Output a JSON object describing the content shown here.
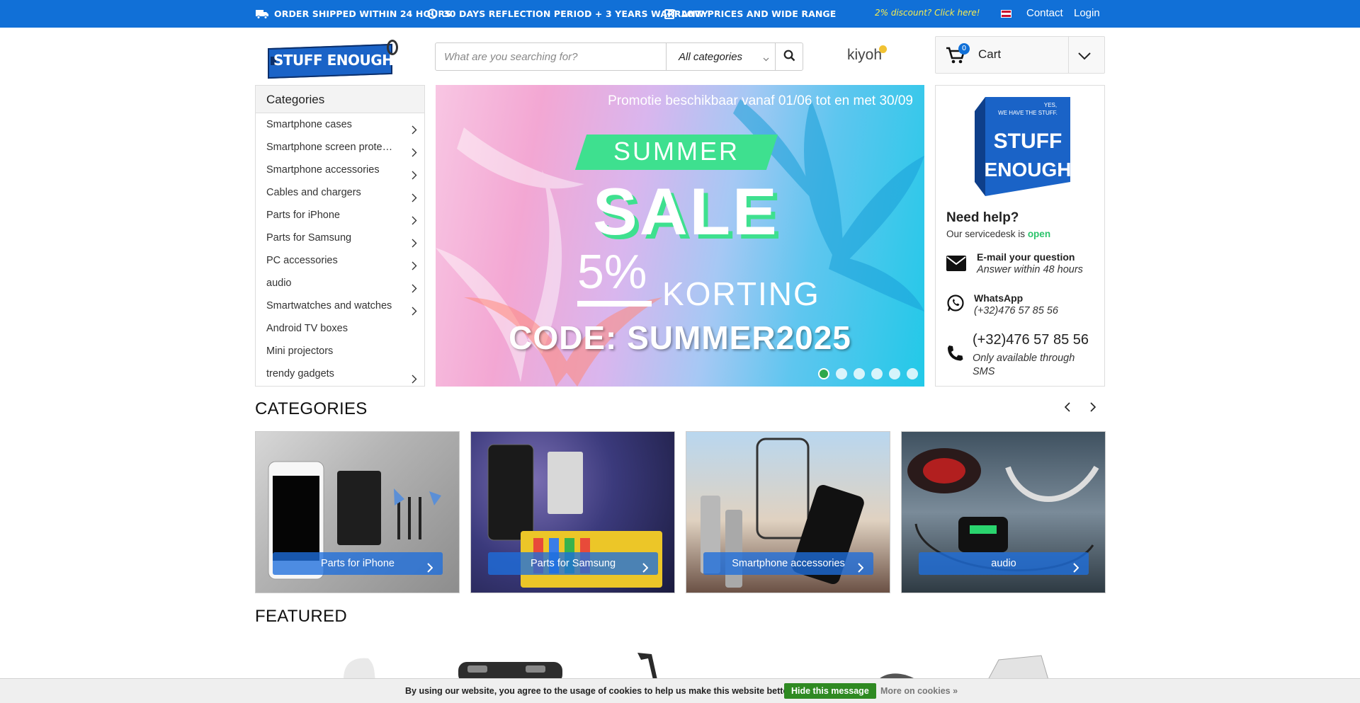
{
  "topbar": {
    "usps": [
      {
        "icon": "truck-icon",
        "text": "ORDER SHIPPED WITHIN 24 HOURS"
      },
      {
        "icon": "clock-icon",
        "text": "30 DAYS REFLECTION PERIOD + 3 YEARS WARRANTY"
      },
      {
        "icon": "check-square-icon",
        "text": "LOW PRICES AND WIDE RANGE"
      }
    ],
    "promo": "2% discount? Click here!",
    "language_flag": "uk-flag-icon",
    "contact": "Contact",
    "login": "Login"
  },
  "header": {
    "logo_text": "STUFF ENOUGH.BE",
    "search": {
      "placeholder": "What are you searching for?",
      "value": "",
      "category": "All categories"
    },
    "kiyoh": "kiyoh",
    "cart": {
      "label": "Cart",
      "count": "0"
    }
  },
  "sidebar": {
    "title": "Categories",
    "items": [
      {
        "label": "Smartphone cases",
        "has_sub": true
      },
      {
        "label": "Smartphone screen protectors",
        "has_sub": true
      },
      {
        "label": "Smartphone accessories",
        "has_sub": true
      },
      {
        "label": "Cables and chargers",
        "has_sub": true
      },
      {
        "label": "Parts for iPhone",
        "has_sub": true
      },
      {
        "label": "Parts for Samsung",
        "has_sub": true
      },
      {
        "label": "PC accessories",
        "has_sub": true
      },
      {
        "label": "audio",
        "has_sub": true
      },
      {
        "label": "Smartwatches and watches",
        "has_sub": true
      },
      {
        "label": "Android TV boxes",
        "has_sub": false
      },
      {
        "label": "Mini projectors",
        "has_sub": false
      },
      {
        "label": "trendy gadgets",
        "has_sub": true
      }
    ]
  },
  "banner": {
    "availability": "Promotie beschikbaar vanaf 01/06 tot en met 30/09",
    "summer": "SUMMER",
    "sale": "SALE",
    "percent": "5%",
    "korting": "KORTING",
    "code": "CODE: SUMMER2025",
    "slide_count": 6,
    "active_slide": 1,
    "accent": "#3ee08f"
  },
  "help": {
    "cube_line1": "YES,",
    "cube_line2": "WE HAVE THE STUFF.",
    "cube_brand1": "STUFF",
    "cube_brand2": "ENOUGH",
    "title": "Need help?",
    "desk_prefix": "Our servicedesk is",
    "desk_status": "open",
    "email_title": "E-mail your question",
    "email_sub": "Answer within 48 hours",
    "whatsapp_title": "WhatsApp",
    "whatsapp_sub": "(+32)476 57 85 56",
    "phone_title": "(+32)476 57 85 56",
    "phone_sub": "Only available through SMS"
  },
  "categories_section": {
    "title": "CATEGORIES",
    "cards": [
      {
        "label": "Parts for iPhone"
      },
      {
        "label": "Parts for Samsung"
      },
      {
        "label": "Smartphone accessories"
      },
      {
        "label": "audio"
      }
    ]
  },
  "featured_section": {
    "title": "FEATURED"
  },
  "cookie": {
    "message": "By using our website, you agree to the usage of cookies to help us make this website better.",
    "hide": "Hide this message",
    "more": "More on cookies »"
  },
  "colors": {
    "brand_blue": "#1170d7",
    "open_green": "#2bc36b",
    "cookie_button": "#2f8a22"
  }
}
